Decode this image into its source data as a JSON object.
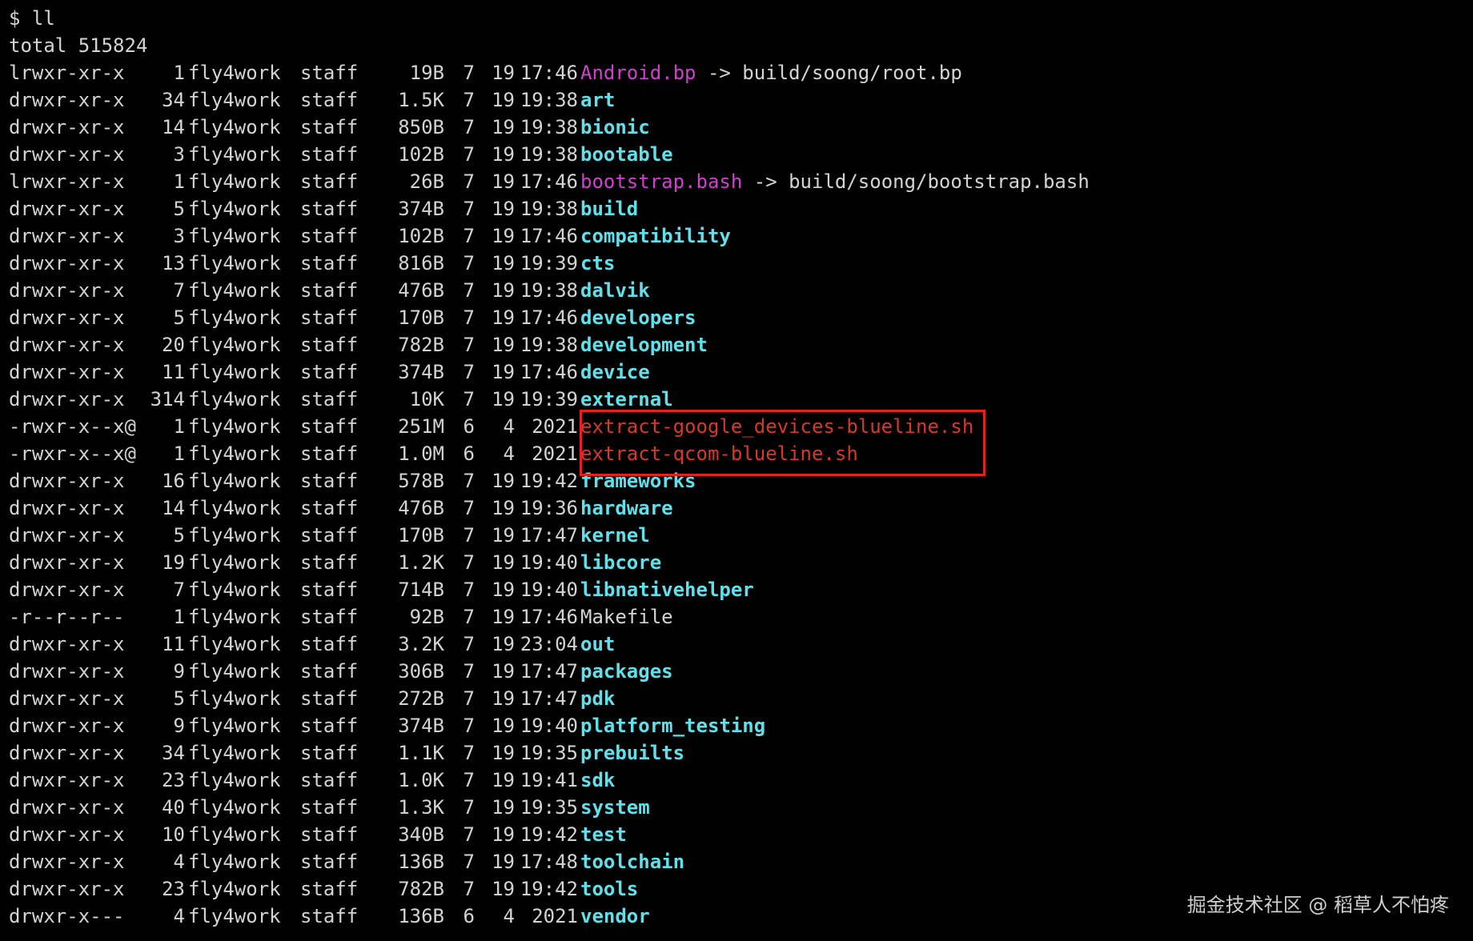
{
  "prompt": "$ ll",
  "total": "total 515824",
  "colors": {
    "background": "#000000",
    "text": "#d4d4d4",
    "symlink": "#d33fd0",
    "directory": "#61e0ea",
    "executable": "#d8382a",
    "highlight_box": "#e5211d"
  },
  "entries": [
    {
      "perms": "lrwxr-xr-x",
      "links": "1",
      "owner": "fly4work",
      "group": "staff",
      "size": "19B",
      "month": "7",
      "day": "19",
      "time": "17:46",
      "name": "Android.bp",
      "type": "link",
      "target": "build/soong/root.bp"
    },
    {
      "perms": "drwxr-xr-x",
      "links": "34",
      "owner": "fly4work",
      "group": "staff",
      "size": "1.5K",
      "month": "7",
      "day": "19",
      "time": "19:38",
      "name": "art",
      "type": "dir"
    },
    {
      "perms": "drwxr-xr-x",
      "links": "14",
      "owner": "fly4work",
      "group": "staff",
      "size": "850B",
      "month": "7",
      "day": "19",
      "time": "19:38",
      "name": "bionic",
      "type": "dir"
    },
    {
      "perms": "drwxr-xr-x",
      "links": "3",
      "owner": "fly4work",
      "group": "staff",
      "size": "102B",
      "month": "7",
      "day": "19",
      "time": "19:38",
      "name": "bootable",
      "type": "dir"
    },
    {
      "perms": "lrwxr-xr-x",
      "links": "1",
      "owner": "fly4work",
      "group": "staff",
      "size": "26B",
      "month": "7",
      "day": "19",
      "time": "17:46",
      "name": "bootstrap.bash",
      "type": "link",
      "target": "build/soong/bootstrap.bash"
    },
    {
      "perms": "drwxr-xr-x",
      "links": "5",
      "owner": "fly4work",
      "group": "staff",
      "size": "374B",
      "month": "7",
      "day": "19",
      "time": "19:38",
      "name": "build",
      "type": "dir"
    },
    {
      "perms": "drwxr-xr-x",
      "links": "3",
      "owner": "fly4work",
      "group": "staff",
      "size": "102B",
      "month": "7",
      "day": "19",
      "time": "17:46",
      "name": "compatibility",
      "type": "dir"
    },
    {
      "perms": "drwxr-xr-x",
      "links": "13",
      "owner": "fly4work",
      "group": "staff",
      "size": "816B",
      "month": "7",
      "day": "19",
      "time": "19:39",
      "name": "cts",
      "type": "dir"
    },
    {
      "perms": "drwxr-xr-x",
      "links": "7",
      "owner": "fly4work",
      "group": "staff",
      "size": "476B",
      "month": "7",
      "day": "19",
      "time": "19:38",
      "name": "dalvik",
      "type": "dir"
    },
    {
      "perms": "drwxr-xr-x",
      "links": "5",
      "owner": "fly4work",
      "group": "staff",
      "size": "170B",
      "month": "7",
      "day": "19",
      "time": "17:46",
      "name": "developers",
      "type": "dir"
    },
    {
      "perms": "drwxr-xr-x",
      "links": "20",
      "owner": "fly4work",
      "group": "staff",
      "size": "782B",
      "month": "7",
      "day": "19",
      "time": "19:38",
      "name": "development",
      "type": "dir"
    },
    {
      "perms": "drwxr-xr-x",
      "links": "11",
      "owner": "fly4work",
      "group": "staff",
      "size": "374B",
      "month": "7",
      "day": "19",
      "time": "17:46",
      "name": "device",
      "type": "dir"
    },
    {
      "perms": "drwxr-xr-x",
      "links": "314",
      "owner": "fly4work",
      "group": "staff",
      "size": "10K",
      "month": "7",
      "day": "19",
      "time": "19:39",
      "name": "external",
      "type": "dir"
    },
    {
      "perms": "-rwxr-x--x@",
      "links": "1",
      "owner": "fly4work",
      "group": "staff",
      "size": "251M",
      "month": "6",
      "day": "4",
      "time": "2021",
      "name": "extract-google_devices-blueline.sh",
      "type": "exec"
    },
    {
      "perms": "-rwxr-x--x@",
      "links": "1",
      "owner": "fly4work",
      "group": "staff",
      "size": "1.0M",
      "month": "6",
      "day": "4",
      "time": "2021",
      "name": "extract-qcom-blueline.sh",
      "type": "exec"
    },
    {
      "perms": "drwxr-xr-x",
      "links": "16",
      "owner": "fly4work",
      "group": "staff",
      "size": "578B",
      "month": "7",
      "day": "19",
      "time": "19:42",
      "name": "frameworks",
      "type": "dir"
    },
    {
      "perms": "drwxr-xr-x",
      "links": "14",
      "owner": "fly4work",
      "group": "staff",
      "size": "476B",
      "month": "7",
      "day": "19",
      "time": "19:36",
      "name": "hardware",
      "type": "dir"
    },
    {
      "perms": "drwxr-xr-x",
      "links": "5",
      "owner": "fly4work",
      "group": "staff",
      "size": "170B",
      "month": "7",
      "day": "19",
      "time": "17:47",
      "name": "kernel",
      "type": "dir"
    },
    {
      "perms": "drwxr-xr-x",
      "links": "19",
      "owner": "fly4work",
      "group": "staff",
      "size": "1.2K",
      "month": "7",
      "day": "19",
      "time": "19:40",
      "name": "libcore",
      "type": "dir"
    },
    {
      "perms": "drwxr-xr-x",
      "links": "7",
      "owner": "fly4work",
      "group": "staff",
      "size": "714B",
      "month": "7",
      "day": "19",
      "time": "19:40",
      "name": "libnativehelper",
      "type": "dir"
    },
    {
      "perms": "-r--r--r--",
      "links": "1",
      "owner": "fly4work",
      "group": "staff",
      "size": "92B",
      "month": "7",
      "day": "19",
      "time": "17:46",
      "name": "Makefile",
      "type": "file"
    },
    {
      "perms": "drwxr-xr-x",
      "links": "11",
      "owner": "fly4work",
      "group": "staff",
      "size": "3.2K",
      "month": "7",
      "day": "19",
      "time": "23:04",
      "name": "out",
      "type": "dir"
    },
    {
      "perms": "drwxr-xr-x",
      "links": "9",
      "owner": "fly4work",
      "group": "staff",
      "size": "306B",
      "month": "7",
      "day": "19",
      "time": "17:47",
      "name": "packages",
      "type": "dir"
    },
    {
      "perms": "drwxr-xr-x",
      "links": "5",
      "owner": "fly4work",
      "group": "staff",
      "size": "272B",
      "month": "7",
      "day": "19",
      "time": "17:47",
      "name": "pdk",
      "type": "dir"
    },
    {
      "perms": "drwxr-xr-x",
      "links": "9",
      "owner": "fly4work",
      "group": "staff",
      "size": "374B",
      "month": "7",
      "day": "19",
      "time": "19:40",
      "name": "platform_testing",
      "type": "dir"
    },
    {
      "perms": "drwxr-xr-x",
      "links": "34",
      "owner": "fly4work",
      "group": "staff",
      "size": "1.1K",
      "month": "7",
      "day": "19",
      "time": "19:35",
      "name": "prebuilts",
      "type": "dir"
    },
    {
      "perms": "drwxr-xr-x",
      "links": "23",
      "owner": "fly4work",
      "group": "staff",
      "size": "1.0K",
      "month": "7",
      "day": "19",
      "time": "19:41",
      "name": "sdk",
      "type": "dir"
    },
    {
      "perms": "drwxr-xr-x",
      "links": "40",
      "owner": "fly4work",
      "group": "staff",
      "size": "1.3K",
      "month": "7",
      "day": "19",
      "time": "19:35",
      "name": "system",
      "type": "dir"
    },
    {
      "perms": "drwxr-xr-x",
      "links": "10",
      "owner": "fly4work",
      "group": "staff",
      "size": "340B",
      "month": "7",
      "day": "19",
      "time": "19:42",
      "name": "test",
      "type": "dir"
    },
    {
      "perms": "drwxr-xr-x",
      "links": "4",
      "owner": "fly4work",
      "group": "staff",
      "size": "136B",
      "month": "7",
      "day": "19",
      "time": "17:48",
      "name": "toolchain",
      "type": "dir"
    },
    {
      "perms": "drwxr-xr-x",
      "links": "23",
      "owner": "fly4work",
      "group": "staff",
      "size": "782B",
      "month": "7",
      "day": "19",
      "time": "19:42",
      "name": "tools",
      "type": "dir"
    },
    {
      "perms": "drwxr-x---",
      "links": "4",
      "owner": "fly4work",
      "group": "staff",
      "size": "136B",
      "month": "6",
      "day": "4",
      "time": "2021",
      "name": "vendor",
      "type": "dir"
    }
  ],
  "watermark": "掘金技术社区 @ 稻草人不怕疼"
}
